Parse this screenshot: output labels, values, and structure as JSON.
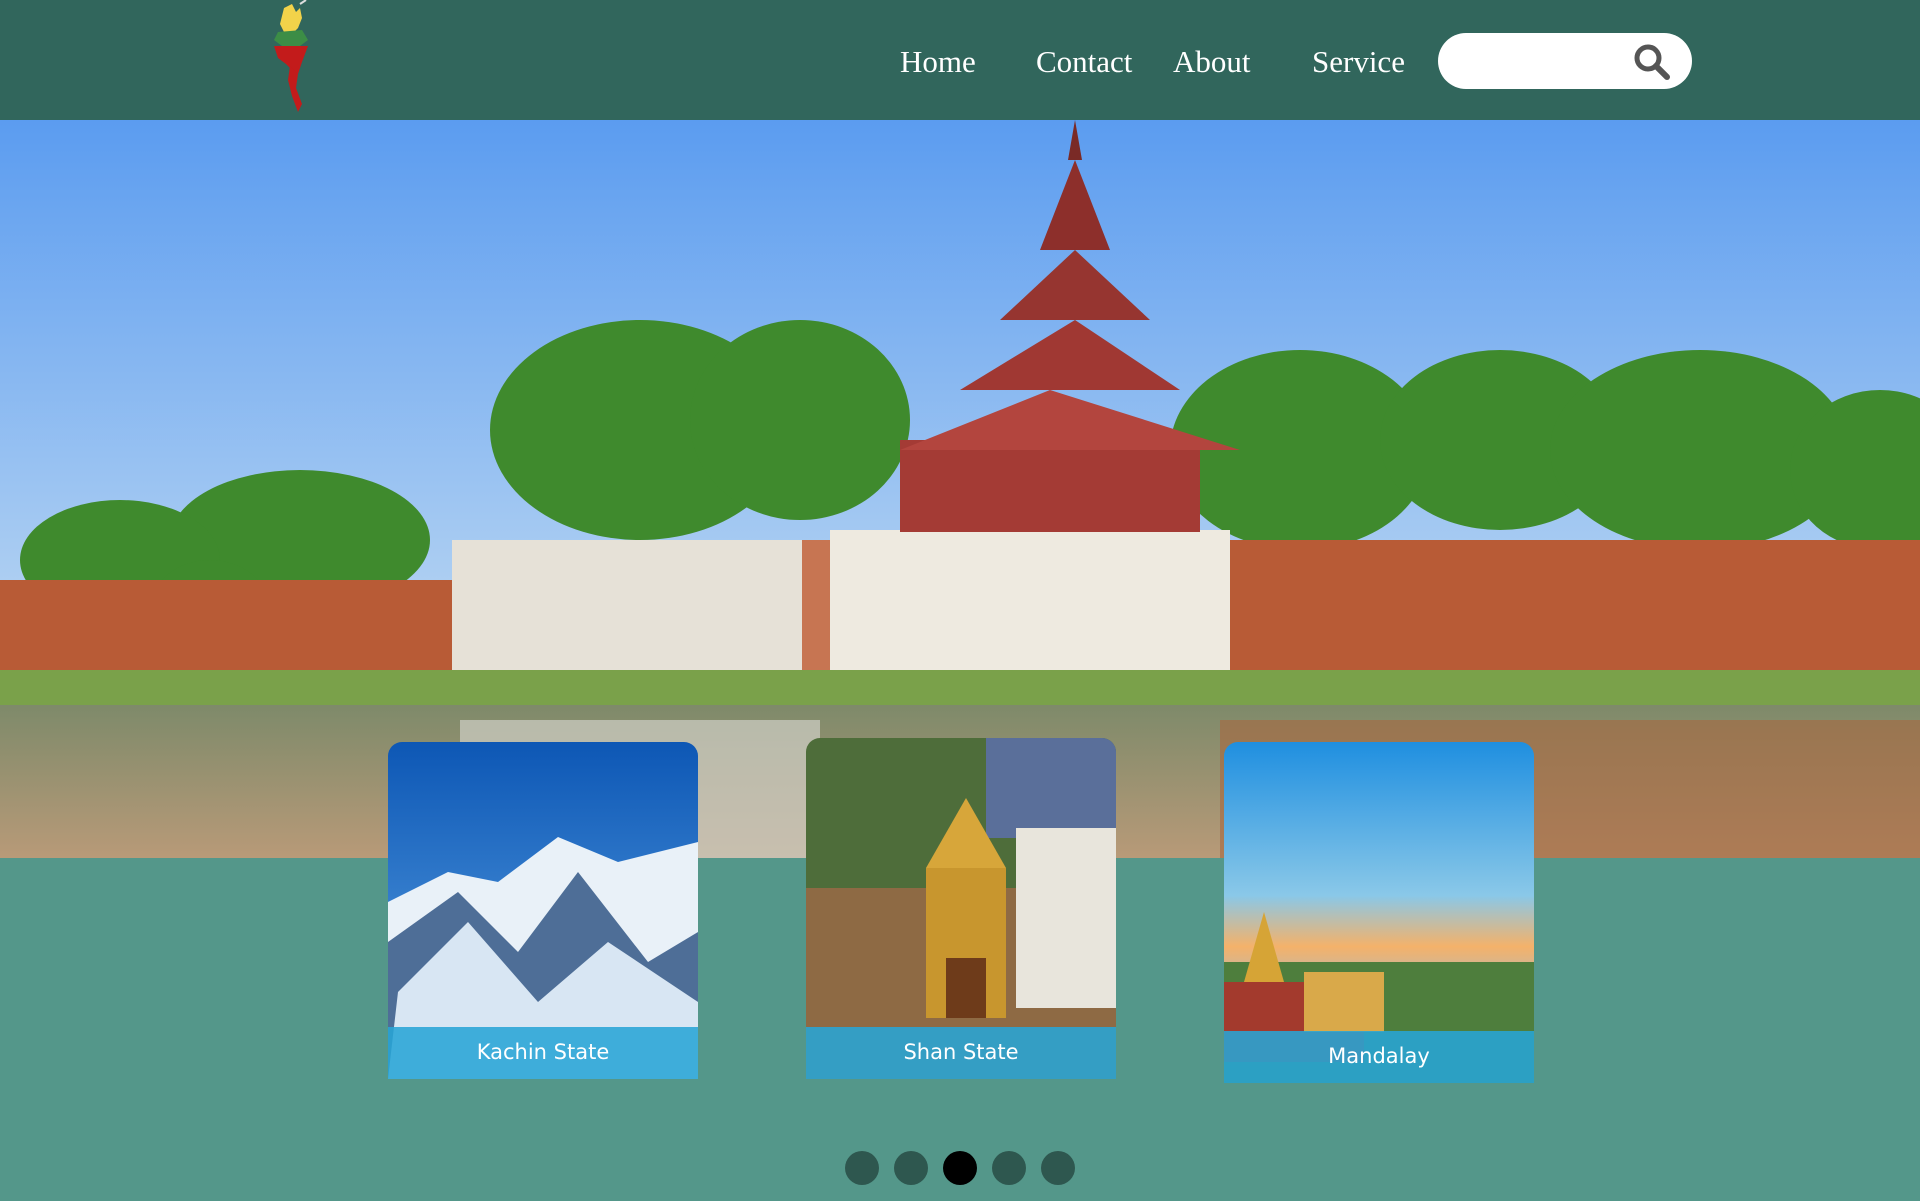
{
  "nav": {
    "home": "Home",
    "contact": "Contact",
    "about": "About",
    "service": "Service"
  },
  "search": {
    "value": "",
    "placeholder": "",
    "icon": "search-icon"
  },
  "cards": [
    {
      "caption": "Kachin State"
    },
    {
      "caption": "Shan State"
    },
    {
      "caption": "Mandalay"
    }
  ],
  "carousel": {
    "slides": 5,
    "active_slide": 3
  },
  "colors": {
    "header": "#31665c",
    "page_background": "#54978a",
    "caption_band": "#28a5d6",
    "dot": "#2e574f",
    "dot_active": "#000000"
  }
}
